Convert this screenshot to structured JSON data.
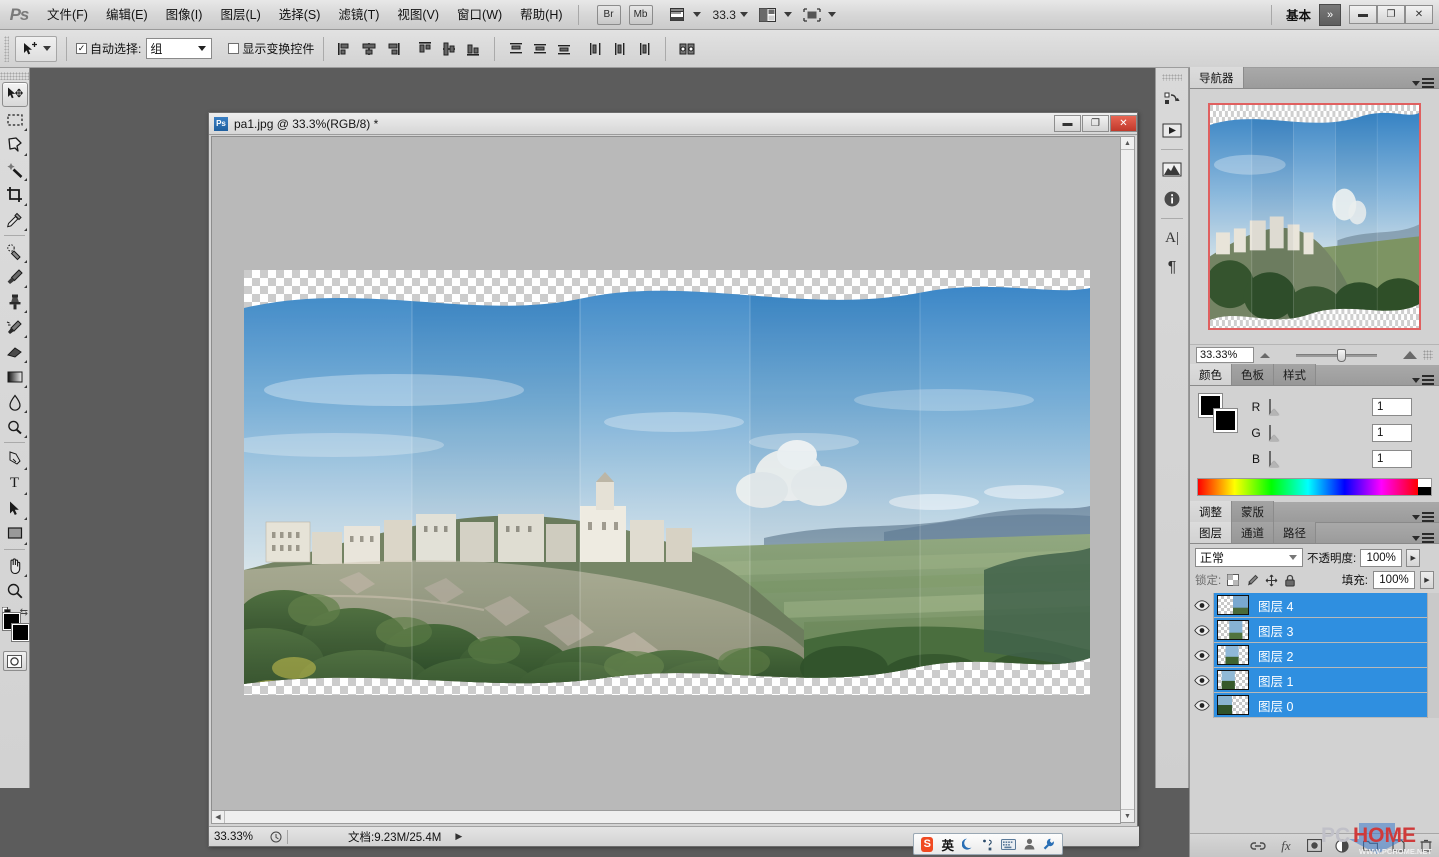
{
  "app": {
    "name": "Adobe Photoshop",
    "logo_text": "Ps"
  },
  "menubar": {
    "items": [
      {
        "label": "文件(F)",
        "name": "menu-file"
      },
      {
        "label": "编辑(E)",
        "name": "menu-edit"
      },
      {
        "label": "图像(I)",
        "name": "menu-image"
      },
      {
        "label": "图层(L)",
        "name": "menu-layer"
      },
      {
        "label": "选择(S)",
        "name": "menu-select"
      },
      {
        "label": "滤镜(T)",
        "name": "menu-filter"
      },
      {
        "label": "视图(V)",
        "name": "menu-view"
      },
      {
        "label": "窗口(W)",
        "name": "menu-window"
      },
      {
        "label": "帮助(H)",
        "name": "menu-help"
      }
    ],
    "bridge_button": "Br",
    "minibridge_button": "Mb",
    "zoom_value": "33.3",
    "workspace_label": "基本",
    "workspace_chevron": "»",
    "window_minimize": "▬",
    "window_restore": "❐",
    "window_close": "✕"
  },
  "optionsbar": {
    "auto_select_label": "自动选择:",
    "auto_select_checked": "✓",
    "auto_select_value": "组",
    "show_transform_label": "显示变换控件",
    "show_transform_checked": "",
    "align_group_1": [
      "align-left-edges",
      "align-horizontal-centers",
      "align-right-edges"
    ],
    "align_group_2": [
      "align-top-edges",
      "align-vertical-centers",
      "align-bottom-edges"
    ],
    "distribute_group_1": [
      "distribute-top-edges",
      "distribute-vertical-centers",
      "distribute-bottom-edges"
    ],
    "distribute_group_2": [
      "distribute-left-edges",
      "distribute-horizontal-centers",
      "distribute-right-edges"
    ],
    "auto_align_label": "auto-align-layers"
  },
  "toolbox": {
    "tools": [
      {
        "name": "move-tool",
        "active": true
      },
      {
        "name": "rectangular-marquee-tool",
        "active": false
      },
      {
        "name": "lasso-tool",
        "active": false
      },
      {
        "name": "magic-wand-tool",
        "active": false
      },
      {
        "name": "crop-tool",
        "active": false
      },
      {
        "name": "eyedropper-tool",
        "active": false
      },
      {
        "name": "spot-healing-brush-tool",
        "active": false
      },
      {
        "name": "brush-tool",
        "active": false
      },
      {
        "name": "clone-stamp-tool",
        "active": false
      },
      {
        "name": "history-brush-tool",
        "active": false
      },
      {
        "name": "eraser-tool",
        "active": false
      },
      {
        "name": "gradient-tool",
        "active": false
      },
      {
        "name": "blur-tool",
        "active": false
      },
      {
        "name": "dodge-tool",
        "active": false
      },
      {
        "name": "pen-tool",
        "active": false
      },
      {
        "name": "horizontal-type-tool",
        "active": false,
        "glyph": "T"
      },
      {
        "name": "path-selection-tool",
        "active": false
      },
      {
        "name": "rectangle-shape-tool",
        "active": false
      },
      {
        "name": "hand-tool",
        "active": false
      },
      {
        "name": "zoom-tool",
        "active": false
      }
    ],
    "foreground_color": "#000000",
    "background_color": "#000000",
    "quick_mask_name": "edit-in-quick-mask-mode"
  },
  "document": {
    "title": "pa1.jpg @ 33.3%(RGB/8) *",
    "icon_text": "Ps",
    "minimize": "▬",
    "restore": "❐",
    "close": "✕",
    "status_zoom": "33.33%",
    "status_doc": "文档:9.23M/25.4M",
    "status_arrow": "▶",
    "status_left_arrow": "◀"
  },
  "icondock": {
    "items": [
      {
        "name": "history-panel-icon"
      },
      {
        "name": "actions-panel-icon"
      },
      {
        "name": "histogram-panel-icon"
      },
      {
        "name": "info-panel-icon"
      },
      {
        "name": "character-panel-icon",
        "glyph": "A"
      },
      {
        "name": "paragraph-panel-icon",
        "glyph": "¶"
      }
    ]
  },
  "navigator": {
    "tabs": [
      {
        "label": "导航器",
        "active": true
      }
    ],
    "zoom_value": "33.33%",
    "view_box_color": "#e06060"
  },
  "color_panel": {
    "tabs": [
      {
        "label": "颜色",
        "active": true
      },
      {
        "label": "色板",
        "active": false
      },
      {
        "label": "样式",
        "active": false
      }
    ],
    "channels": [
      {
        "label": "R",
        "value": "1",
        "color": "#ff0000"
      },
      {
        "label": "G",
        "value": "1",
        "color": "#00ff00"
      },
      {
        "label": "B",
        "value": "1",
        "color": "#0000ff"
      }
    ]
  },
  "adjustments_panel": {
    "tabs": [
      {
        "label": "调整",
        "active": true
      },
      {
        "label": "蒙版",
        "active": false
      }
    ]
  },
  "layers_panel": {
    "tabs": [
      {
        "label": "图层",
        "active": true
      },
      {
        "label": "通道",
        "active": false
      },
      {
        "label": "路径",
        "active": false
      }
    ],
    "blend_mode": "正常",
    "opacity_label": "不透明度:",
    "opacity_value": "100%",
    "lock_label": "锁定:",
    "fill_label": "填充:",
    "fill_value": "100%",
    "lock_icons": [
      "lock-transparent-pixels-icon",
      "lock-image-pixels-icon",
      "lock-position-icon",
      "lock-all-icon"
    ],
    "layers": [
      {
        "name": "图层 4",
        "visible": true,
        "selected": true
      },
      {
        "name": "图层 3",
        "visible": true,
        "selected": true
      },
      {
        "name": "图层 2",
        "visible": true,
        "selected": true
      },
      {
        "name": "图层 1",
        "visible": true,
        "selected": true
      },
      {
        "name": "图层 0",
        "visible": true,
        "selected": true
      }
    ],
    "bottom_buttons": [
      {
        "name": "link-layers-button",
        "glyph": "🔗"
      },
      {
        "name": "add-layer-style-button",
        "glyph": "fx"
      },
      {
        "name": "add-layer-mask-button",
        "glyph": "◻"
      },
      {
        "name": "new-fill-adjustment-layer-button",
        "glyph": "◑"
      },
      {
        "name": "new-group-button",
        "glyph": "🗀"
      }
    ]
  },
  "watermark": {
    "text_pc": "PC",
    "text_home": "HOME",
    "url": "WWW.PCHOME.NET",
    "color_pc": "#c0c0c8",
    "color_home": "#cf3a3a"
  },
  "ime": {
    "logo": "S",
    "mode": "英",
    "icons": [
      "moon-icon",
      "punctuation-icon",
      "soft-keyboard-icon",
      "user-icon",
      "settings-wrench-icon"
    ]
  },
  "canvas": {
    "image_description": "panorama-gordes-france",
    "zoom": "33.3%"
  }
}
